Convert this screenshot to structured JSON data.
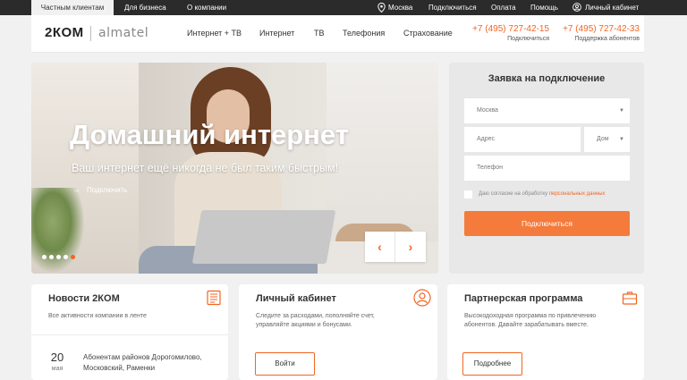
{
  "topbar": {
    "tabs": [
      "Частным клиентам",
      "Для бизнеса",
      "О компании"
    ],
    "city": "Москва",
    "connect": "Подключиться",
    "pay": "Оплата",
    "help": "Помощь",
    "account": "Личный кабинет"
  },
  "header": {
    "logo": "2КОМ",
    "logo2": "almatel",
    "nav": [
      "Интернет + ТВ",
      "Интернет",
      "ТВ",
      "Телефония",
      "Страхование"
    ],
    "phones": [
      {
        "number": "+7 (495) 727-42-15",
        "label": "Подключиться"
      },
      {
        "number": "+7 (495) 727-42-33",
        "label": "Поддержка абонентов"
      }
    ]
  },
  "hero": {
    "title": "Домашний интернет",
    "subtitle": "Ваш интернет ещё никогда не был таким быстрым!",
    "link": "Подключить",
    "slides_total": 5,
    "active_slide": 5
  },
  "form": {
    "title": "Заявка на подключение",
    "city": "Москва",
    "address_placeholder": "Адрес",
    "house_placeholder": "Дом",
    "phone_placeholder": "Телефон",
    "agree_text": "Даю согласие на обработку ",
    "agree_link": "персональных данных",
    "submit": "Подключиться"
  },
  "cards": {
    "news": {
      "title": "Новости 2КОМ",
      "text": "Все активности компании в ленте",
      "day": "20",
      "month": "мая",
      "item_line1": "Абонентам районов Дорогомилово,",
      "item_line2": "Московский, Раменки"
    },
    "cabinet": {
      "title": "Личный кабинет",
      "line1": "Следите за расходами, пополняйте счет,",
      "line2": "управляйте акциями и бонусами.",
      "button": "Войти"
    },
    "partner": {
      "title": "Партнерская программа",
      "line1": "Высокодоходная программа по привлечению",
      "line2": "абонентов. Давайте зарабатывать вместе.",
      "button": "Подробнее"
    }
  },
  "colors": {
    "accent": "#f26522",
    "topbar": "#2b2b2b"
  }
}
